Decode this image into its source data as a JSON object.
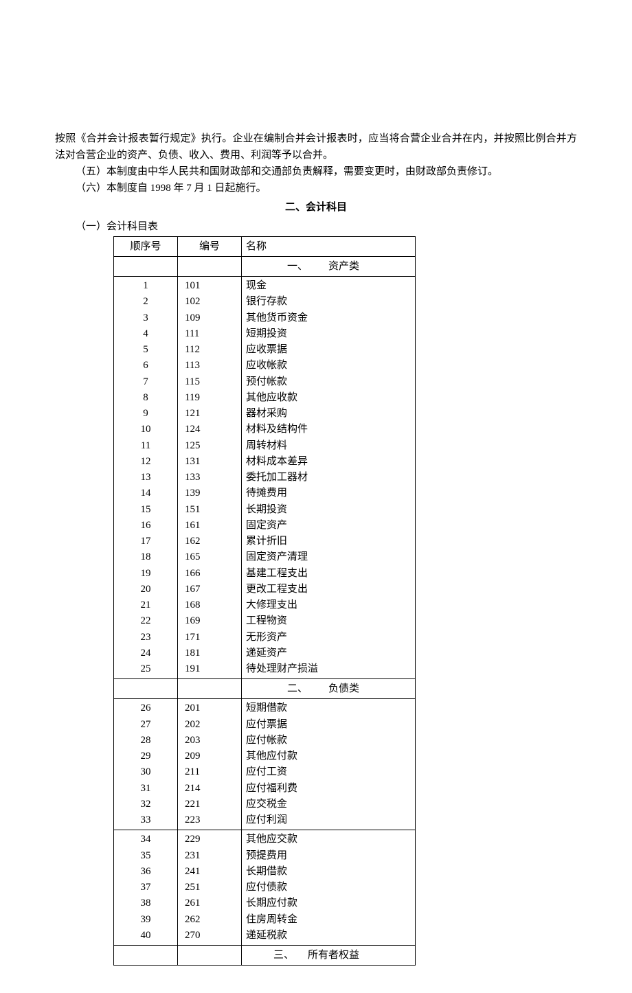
{
  "paragraph1": "按照《合并会计报表暂行规定》执行。企业在编制合并会计报表时，应当将合营企业合并在内，并按照比例合并方法对合营企业的资产、负债、收入、费用、利润等予以合并。",
  "paragraph2": "（五）本制度由中华人民共和国财政部和交通部负责解释，需要变更时，由财政部负责修订。",
  "paragraph3": "（六）本制度自 1998 年 7 月 1 日起施行。",
  "sectionTitle": "二、会计科目",
  "subsectionTitle": "（一）会计科目表",
  "headers": {
    "seq": "顺序号",
    "code": "编号",
    "name": "名称"
  },
  "categories": {
    "cat1_prefix": "一、",
    "cat1_name": "资产类",
    "cat2_prefix": "二、",
    "cat2_name": "负债类",
    "cat3_prefix": "三、",
    "cat3_name": "所有者权益"
  },
  "group1": [
    {
      "seq": "1",
      "code": "101",
      "name": "现金"
    },
    {
      "seq": "2",
      "code": "102",
      "name": "银行存款"
    },
    {
      "seq": "3",
      "code": "109",
      "name": "其他货币资金"
    },
    {
      "seq": "4",
      "code": "111",
      "name": "短期投资"
    },
    {
      "seq": "5",
      "code": "112",
      "name": "应收票据"
    },
    {
      "seq": "6",
      "code": "113",
      "name": "应收帐款"
    },
    {
      "seq": "7",
      "code": "115",
      "name": "预付帐款"
    },
    {
      "seq": "8",
      "code": "119",
      "name": "其他应收款"
    },
    {
      "seq": "9",
      "code": "121",
      "name": "器材采购"
    },
    {
      "seq": "10",
      "code": "124",
      "name": "材料及结构件"
    },
    {
      "seq": "11",
      "code": "125",
      "name": "周转材料"
    },
    {
      "seq": "12",
      "code": "131",
      "name": "材料成本差异"
    },
    {
      "seq": "13",
      "code": "133",
      "name": "委托加工器材"
    },
    {
      "seq": "14",
      "code": "139",
      "name": "待摊费用"
    },
    {
      "seq": "15",
      "code": "151",
      "name": "长期投资"
    },
    {
      "seq": "16",
      "code": "161",
      "name": "固定资产"
    },
    {
      "seq": "17",
      "code": "162",
      "name": "累计折旧"
    },
    {
      "seq": "18",
      "code": "165",
      "name": "固定资产清理"
    },
    {
      "seq": "19",
      "code": "166",
      "name": "基建工程支出"
    },
    {
      "seq": "20",
      "code": "167",
      "name": "更改工程支出"
    },
    {
      "seq": "21",
      "code": "168",
      "name": "大修理支出"
    },
    {
      "seq": "22",
      "code": "169",
      "name": "工程物资"
    },
    {
      "seq": "23",
      "code": "171",
      "name": "无形资产"
    },
    {
      "seq": "24",
      "code": "181",
      "name": "递延资产"
    },
    {
      "seq": "25",
      "code": "191",
      "name": "待处理财产损溢"
    }
  ],
  "group2a": [
    {
      "seq": "26",
      "code": "201",
      "name": "短期借款"
    },
    {
      "seq": "27",
      "code": "202",
      "name": "应付票据"
    },
    {
      "seq": "28",
      "code": "203",
      "name": "应付帐款"
    },
    {
      "seq": "29",
      "code": "209",
      "name": "其他应付款"
    },
    {
      "seq": "30",
      "code": "211",
      "name": "应付工资"
    },
    {
      "seq": "31",
      "code": "214",
      "name": "应付福利费"
    },
    {
      "seq": "32",
      "code": "221",
      "name": "应交税金"
    },
    {
      "seq": "33",
      "code": "223",
      "name": "应付利润"
    }
  ],
  "group2b": [
    {
      "seq": "34",
      "code": "229",
      "name": "其他应交款"
    },
    {
      "seq": "35",
      "code": "231",
      "name": "预提费用"
    },
    {
      "seq": "36",
      "code": "241",
      "name": "长期借款"
    },
    {
      "seq": "37",
      "code": "251",
      "name": "应付债款"
    },
    {
      "seq": "38",
      "code": "261",
      "name": "长期应付款"
    },
    {
      "seq": "39",
      "code": "262",
      "name": "住房周转金"
    },
    {
      "seq": "40",
      "code": "270",
      "name": "递延税款"
    }
  ]
}
